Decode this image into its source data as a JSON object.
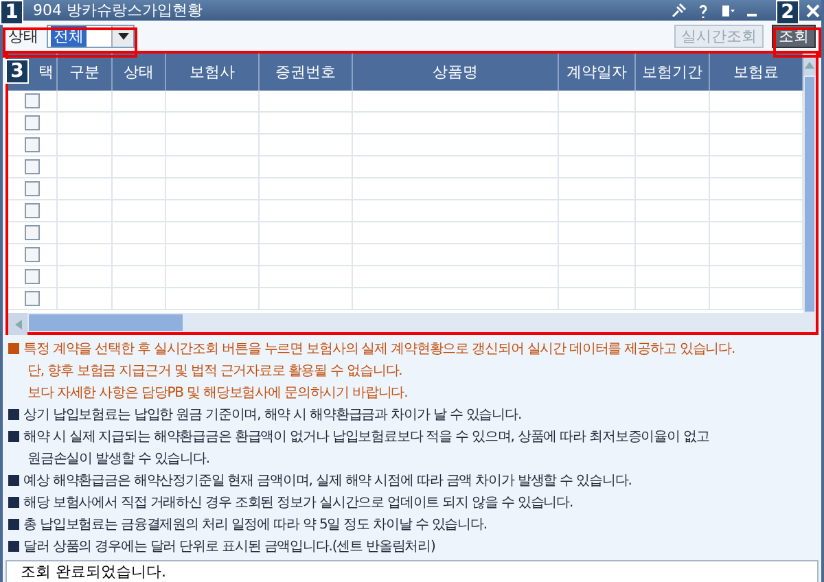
{
  "window": {
    "title": "904 방카슈랑스가입현황"
  },
  "callouts": [
    "1",
    "2",
    "3"
  ],
  "filter": {
    "label": "상태",
    "value": "전체"
  },
  "buttons": [
    {
      "label": "실시간조회",
      "disabled": true
    },
    {
      "label": "조회",
      "disabled": false
    }
  ],
  "table": {
    "columns": [
      "택",
      "구분",
      "상태",
      "보험사",
      "증권번호",
      "상품명",
      "계약일자",
      "보험기간",
      "보험료"
    ],
    "rows": [
      {
        "checked": false
      },
      {
        "checked": false
      },
      {
        "checked": false
      },
      {
        "checked": false
      },
      {
        "checked": false
      },
      {
        "checked": false
      },
      {
        "checked": false
      },
      {
        "checked": false
      },
      {
        "checked": false
      },
      {
        "checked": false
      }
    ]
  },
  "notes": [
    {
      "kind": "alert_bullet",
      "text": "특정 계약을 선택한 후 실시간조회 버튼을 누르면 보험사의 실제 계약현황으로 갱신되어 실시간 데이터를 제공하고 있습니다."
    },
    {
      "kind": "alert_line",
      "text": "단, 향후 보험금 지급근거 및 법적 근거자료로 활용될 수 없습니다."
    },
    {
      "kind": "alert_line",
      "text": "보다 자세한 사항은 담당PB 및 해당보험사에 문의하시기 바랍니다."
    },
    {
      "kind": "bullet",
      "text": "상기 납입보험료는 납입한 원금 기준이며, 해약 시 해약환급금과 차이가 날 수 있습니다."
    },
    {
      "kind": "bullet",
      "text": "해약 시 실제 지급되는 해약환급금은 환급액이 없거나 납입보험료보다 적을 수 있으며, 상품에 따라 최저보증이율이 없고"
    },
    {
      "kind": "line",
      "text": "원금손실이 발생할 수 있습니다."
    },
    {
      "kind": "bullet",
      "text": "예상 해약환급금은 해약산정기준일 현재 금액이며, 실제 해약 시점에 따라 금액 차이가 발생할 수 있습니다."
    },
    {
      "kind": "bullet",
      "text": "해당 보험사에서 직접 거래하신 경우 조회된 정보가 실시간으로 업데이트 되지 않을 수 있습니다."
    },
    {
      "kind": "bullet",
      "text": "총 납입보험료는 금융결제원의 처리 일정에 따라 약 5일 정도 차이날 수 있습니다."
    },
    {
      "kind": "bullet",
      "text": "달러 상품의 경우에는 달러 단위로 표시된 금액입니다.(센트 반올림처리)"
    }
  ],
  "status_bar": "조회 완료되었습니다."
}
